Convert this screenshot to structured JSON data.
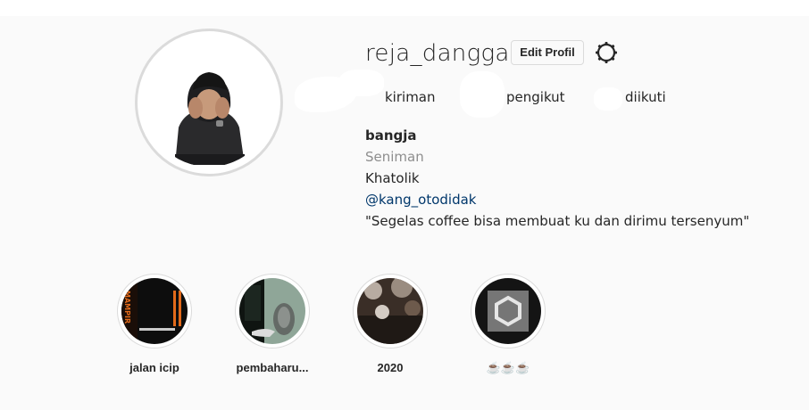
{
  "profile": {
    "username": "reja_dangga",
    "edit_label": "Edit Profil",
    "settings_icon": "gear-icon",
    "avatar": "person-in-black-hoodie-photo"
  },
  "stats": {
    "posts_label": "kiriman",
    "followers_label": "pengikut",
    "following_label": "diikuti"
  },
  "bio": {
    "name": "bangja",
    "category": "Seniman",
    "line1": "Khatolik",
    "mention": "@kang_otodidak",
    "quote": "\"Segelas coffee bisa membuat ku dan dirimu tersenyum\""
  },
  "highlights": [
    {
      "label": "jalan icip",
      "cover": "dark-orange-sign-photo"
    },
    {
      "label": "pembaharu...",
      "cover": "sneaker-on-green-photo"
    },
    {
      "label": "2020",
      "cover": "cafe-blur-photo"
    },
    {
      "label": "☕☕☕",
      "cover": "hexagon-logo-icon"
    }
  ],
  "colors": {
    "background": "#fafafa",
    "border": "#dbdbdb",
    "link": "#00376b",
    "muted": "#8e8e8e"
  }
}
